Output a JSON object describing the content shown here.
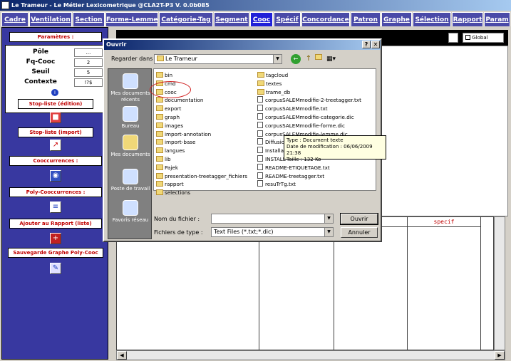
{
  "app": {
    "title": "Le Trameur - Le Métier Lexicometrique @CLA2T-P3 V. 0.0b085"
  },
  "tabs": [
    "Cadre",
    "Ventilation",
    "Section",
    "Forme-Lemme",
    "Catégorie-Tag",
    "Segment",
    "Cooc",
    "Spécif",
    "Concordance",
    "Patron",
    "Graphe",
    "Sélection",
    "Rapport",
    "Param"
  ],
  "active_tab": "Cooc",
  "left_panel": {
    "params_title": "Paramètres :",
    "params": [
      {
        "label": "Pôle",
        "value": "..."
      },
      {
        "label": "Fq-Cooc",
        "value": "2"
      },
      {
        "label": "Seuil",
        "value": "5"
      },
      {
        "label": "Contexte",
        "value": "!?$"
      }
    ],
    "info_icon": "info-icon",
    "stoplist_edit": "Stop-liste (édition)",
    "stoplist_import": "Stop-liste (import)",
    "cooc": "Cooccurrences :",
    "polycooc": "Poly-Cooccurrences :",
    "add_report": "Ajouter au Rapport (liste)",
    "save_graph": "Sauvegarde Graphe Poly-Cooc"
  },
  "main": {
    "global_label": "Global",
    "grid_header_specif": "specif"
  },
  "dialog": {
    "title": "Ouvrir",
    "help": "?",
    "close": "✕",
    "look_in_label": "Regarder dans :",
    "look_in_value": "Le Trameur",
    "places": [
      "Mes documents récents",
      "Bureau",
      "Mes documents",
      "Poste de travail",
      "Favoris réseau"
    ],
    "folders_col1": [
      "bin",
      "cmd",
      "cooc",
      "documentation",
      "export",
      "graph",
      "images",
      "import-annotation",
      "import-base",
      "langues",
      "lib",
      "Pajek",
      "presentation-treetagger_fichiers",
      "rapport",
      "selections"
    ],
    "items_col2": [
      {
        "name": "tagcloud",
        "type": "folder"
      },
      {
        "name": "textes",
        "type": "folder"
      },
      {
        "name": "trame_db",
        "type": "folder"
      },
      {
        "name": "corpusSALEMmodifie-2-treetagger.txt",
        "type": "file"
      },
      {
        "name": "corpusSALEMmodifie.txt",
        "type": "file"
      },
      {
        "name": "corpusSALEMmodifie-categorie.dic",
        "type": "file"
      },
      {
        "name": "corpusSALEMmodifie-forme.dic",
        "type": "file"
      },
      {
        "name": "corpusSALEMmodifie-lemme.dic",
        "type": "file"
      },
      {
        "name": "Diffusion",
        "type": "file"
      },
      {
        "name": "Installat",
        "type": "file"
      },
      {
        "name": "INSTALL",
        "type": "file"
      },
      {
        "name": "README-ETIQUETAGE.txt",
        "type": "file"
      },
      {
        "name": "README-treetagger.txt",
        "type": "file"
      },
      {
        "name": "resuTrTg.txt",
        "type": "file"
      }
    ],
    "tooltip": {
      "line1": "Type : Document texte",
      "line2": "Date de modification : 06/06/2009 21:38",
      "line3": "Taille : 132 Ko"
    },
    "filename_label": "Nom du fichier :",
    "filename_value": "",
    "filetype_label": "Fichiers de type :",
    "filetype_value": "Text Files (*.txt;*.dic)",
    "open_btn": "Ouvrir",
    "cancel_btn": "Annuler"
  }
}
